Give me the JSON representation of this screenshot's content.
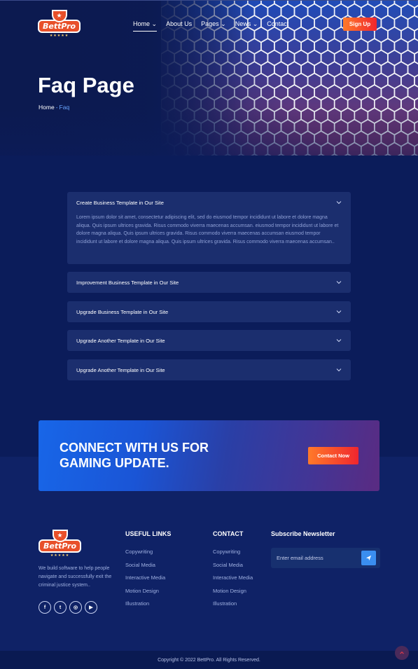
{
  "brand": {
    "name": "BettPro"
  },
  "nav": {
    "items": [
      {
        "label": "Home",
        "has_dropdown": true,
        "active": true
      },
      {
        "label": "About Us",
        "has_dropdown": false
      },
      {
        "label": "Pages",
        "has_dropdown": true
      },
      {
        "label": "News",
        "has_dropdown": true
      },
      {
        "label": "Contact",
        "has_dropdown": false
      }
    ],
    "signup_label": "Sign Up"
  },
  "hero": {
    "title": "Faq Page",
    "breadcrumb": {
      "home": "Home",
      "separator": "-",
      "current": "Faq"
    }
  },
  "faq": {
    "items": [
      {
        "question": "Create Business Template in Our Site",
        "expanded": true,
        "answer": "Lorem ipsum dolor sit amet, consectetur adipiscing elit, sed do eiusmod tempor incididunt ut labore et dolore magna aliqua. Quis ipsum ultrices gravida. Risus commodo viverra maecenas accumsan. eiusmod tempor incididunt ut labore et dolore magna aliqua. Quis ipsum ultrices gravida. Risus commodo viverra maecenas accumsan eiusmod tempor incididunt ut labore et dolore magna aliqua. Quis ipsum ultrices gravida. Risus commodo viverra maecenas accumsan.."
      },
      {
        "question": "Improvement Business Template in Our Site",
        "expanded": false
      },
      {
        "question": "Upgrade Business Template in Our Site",
        "expanded": false
      },
      {
        "question": "Upgrade Another Template in Our Site",
        "expanded": false
      },
      {
        "question": "Upgrade Another Template in Our Site",
        "expanded": false
      }
    ]
  },
  "cta": {
    "title": "CONNECT WITH US FOR GAMING UPDATE.",
    "button_label": "Contact Now"
  },
  "footer": {
    "about": "We build software to help people navigate and successfully exit the criminal justice system..",
    "socials": [
      {
        "name": "facebook-icon",
        "glyph": "f"
      },
      {
        "name": "twitter-icon",
        "glyph": "t"
      },
      {
        "name": "instagram-icon",
        "glyph": "◎"
      },
      {
        "name": "youtube-icon",
        "glyph": "▶"
      }
    ],
    "useful_links": {
      "title": "USEFUL LINKS",
      "links": [
        "Copywriting",
        "Social Media",
        "Interactive Media",
        "Motion Design",
        "Illustration"
      ]
    },
    "contact": {
      "title": "CONTACT",
      "links": [
        "Copywriting",
        "Social Media",
        "Interactive Media",
        "Motion Design",
        "Illustration"
      ]
    },
    "newsletter": {
      "title": "Subscribe Newsletter",
      "placeholder": "Enter email address"
    },
    "copyright": "Copyright © 2022 BettPro. All Rights Reserved."
  },
  "colors": {
    "background": "#0b1c5a",
    "accent_orange": "#ff7a2a",
    "accent_red": "#f0262e",
    "link_blue": "#6aa6ff"
  }
}
